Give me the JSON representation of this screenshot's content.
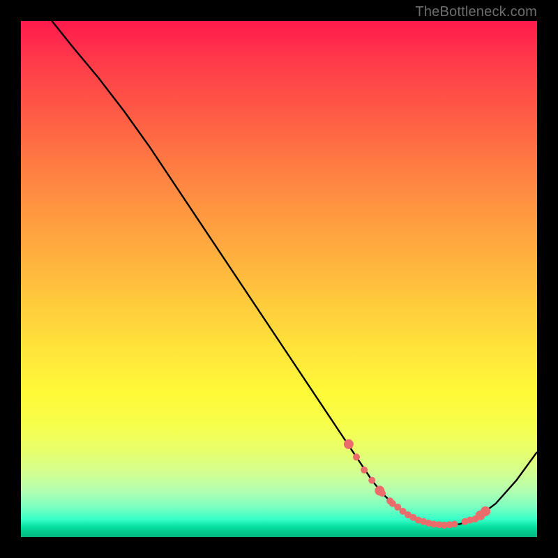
{
  "watermark": "TheBottleneck.com",
  "colors": {
    "frame": "#000000",
    "curve": "#000000",
    "markers": "#ec6b6b",
    "watermark": "#6d6d6d",
    "gradient_top": "#ff1a4d",
    "gradient_bottom": "#02b97f"
  },
  "chart_data": {
    "type": "line",
    "title": "",
    "xlabel": "",
    "ylabel": "",
    "xlim": [
      0,
      100
    ],
    "ylim": [
      0,
      100
    ],
    "grid": false,
    "legend": false,
    "series": [
      {
        "name": "curve",
        "x": [
          6,
          10,
          15,
          20,
          25,
          30,
          35,
          40,
          45,
          50,
          55,
          60,
          62,
          65,
          68,
          70,
          72,
          74,
          76,
          78,
          80,
          82,
          85,
          88,
          92,
          96,
          100
        ],
        "y": [
          100,
          95,
          89,
          82.5,
          75.5,
          68,
          60.5,
          53,
          45.5,
          38,
          30.5,
          23,
          20,
          15.5,
          11,
          8.5,
          6.5,
          5,
          3.8,
          3,
          2.5,
          2.3,
          2.5,
          3.5,
          6.5,
          11,
          16.5
        ]
      }
    ],
    "markers": [
      {
        "x": 63.5,
        "y": 18
      },
      {
        "x": 65,
        "y": 15.5
      },
      {
        "x": 66.5,
        "y": 13
      },
      {
        "x": 68,
        "y": 11
      },
      {
        "x": 69.5,
        "y": 9
      },
      {
        "x": 70,
        "y": 8.5
      },
      {
        "x": 71.5,
        "y": 7
      },
      {
        "x": 72,
        "y": 6.5
      },
      {
        "x": 73,
        "y": 5.8
      },
      {
        "x": 74,
        "y": 5
      },
      {
        "x": 75,
        "y": 4.3
      },
      {
        "x": 76,
        "y": 3.8
      },
      {
        "x": 77,
        "y": 3.3
      },
      {
        "x": 78,
        "y": 3
      },
      {
        "x": 79,
        "y": 2.7
      },
      {
        "x": 80,
        "y": 2.5
      },
      {
        "x": 81,
        "y": 2.4
      },
      {
        "x": 82,
        "y": 2.3
      },
      {
        "x": 83,
        "y": 2.4
      },
      {
        "x": 84,
        "y": 2.5
      },
      {
        "x": 86,
        "y": 3
      },
      {
        "x": 87,
        "y": 3.3
      },
      {
        "x": 88,
        "y": 3.5
      },
      {
        "x": 89,
        "y": 4.2
      },
      {
        "x": 90,
        "y": 5
      }
    ]
  }
}
